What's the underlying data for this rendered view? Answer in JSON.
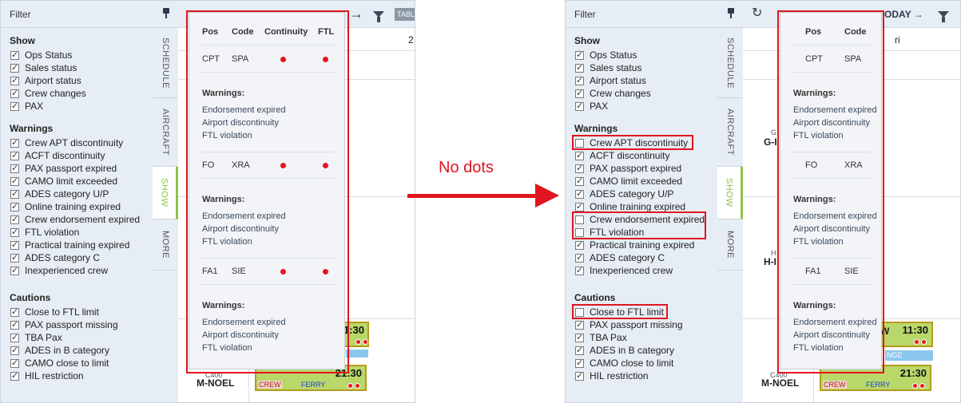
{
  "filter": {
    "title": "Filter",
    "show_title": "Show",
    "show_items": [
      "Ops Status",
      "Sales status",
      "Airport status",
      "Crew changes",
      "PAX"
    ],
    "warnings_title": "Warnings",
    "warnings_items": [
      "Crew APT discontinuity",
      "ACFT discontinuity",
      "PAX passport expired",
      "CAMO limit exceeded",
      "ADES category U/P",
      "Online training expired",
      "Crew endorsement expired",
      "FTL violation",
      "Practical training expired",
      "ADES category C",
      "Inexperienced crew"
    ],
    "cautions_title": "Cautions",
    "cautions_items": [
      "Close to FTL limit",
      "PAX passport missing",
      "TBA Pax",
      "ADES in B category",
      "CAMO close to limit",
      "HIL restriction"
    ],
    "left_unchecked": [],
    "right_unchecked": [
      "Crew APT discontinuity",
      "Crew endorsement expired",
      "FTL violation",
      "Close to FTL limit"
    ]
  },
  "tabs": [
    "SCHEDULE",
    "AIRCRAFT",
    "SHOW",
    "MORE"
  ],
  "toolbar": {
    "tablet_label": "TABL",
    "today_label": "ODAY →",
    "date_partial_left": "2",
    "date_partial_right": "ri"
  },
  "popup": {
    "headers_left": [
      "Pos",
      "Code",
      "Continuity",
      "FTL"
    ],
    "headers_right": [
      "Pos",
      "Code"
    ],
    "crew": [
      {
        "pos": "CPT",
        "code": "SPA"
      },
      {
        "pos": "FO",
        "code": "XRA"
      },
      {
        "pos": "FA1",
        "code": "SIE"
      }
    ],
    "warnings_label": "Warnings:",
    "warning_items": [
      "Endorsement expired",
      "Airport discontinuity",
      "FTL violation"
    ]
  },
  "annotation": {
    "text": "No dots"
  },
  "schedule": {
    "reg_1": "G-I",
    "reg_1_small": "G",
    "reg_2": "H-I",
    "reg_2_small": "H",
    "reg_3": "M-NOEL",
    "reg_3_small": "C400",
    "flight_time_1": "11:30",
    "flight_time_2": "21:30",
    "flight_crew": "CREW",
    "flight_ferry": "FERRY",
    "change_label": "NGE",
    "w_label": "W"
  },
  "colors": {
    "accent_red": "#e0151f",
    "show_tab": "#8bc34a",
    "dot_red": "#e8141e",
    "panel_bg": "#e6edf4"
  }
}
